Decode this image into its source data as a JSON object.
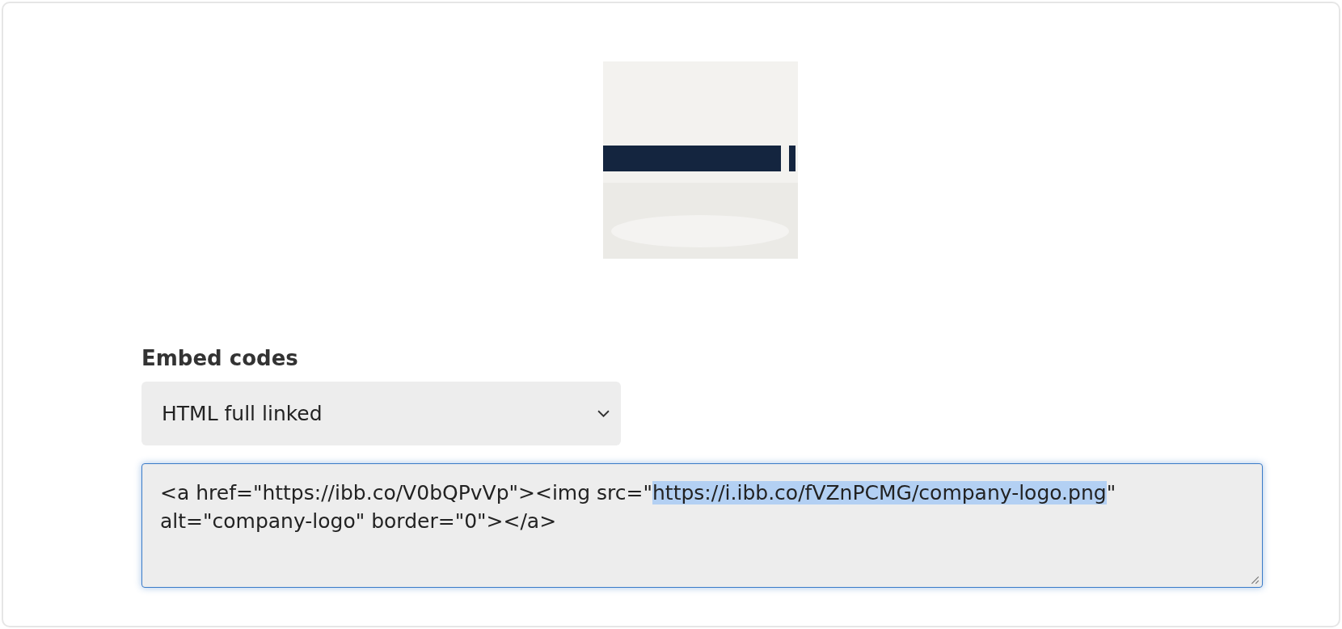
{
  "embed": {
    "label": "Embed codes",
    "select": {
      "value": "HTML full linked"
    },
    "code": {
      "before": "<a href=\"https://ibb.co/V0bQPvVp\"><img src=\"",
      "selected": "https://i.ibb.co/fVZnPCMG/company-logo.png",
      "after": "\" alt=\"company-logo\" border=\"0\"></a>",
      "focused": true
    }
  }
}
